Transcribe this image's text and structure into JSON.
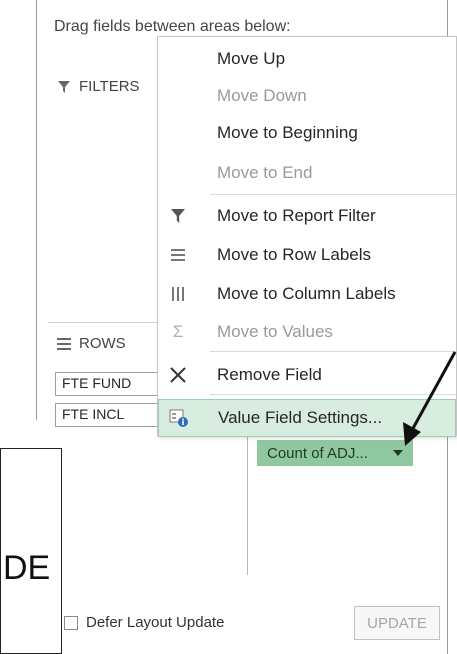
{
  "panel": {
    "drag_hint": "Drag fields between areas below:",
    "filters_label": "FILTERS",
    "rows_label": "ROWS",
    "row_fields": [
      "FTE FUND",
      "FTE INCL"
    ],
    "value_field": "Count of ADJ...",
    "defer_label": "Defer Layout Update",
    "update_label": "UPDATE"
  },
  "context_menu": {
    "items": [
      {
        "label": "Move Up",
        "enabled": true,
        "icon": ""
      },
      {
        "label": "Move Down",
        "enabled": false,
        "icon": ""
      },
      {
        "label": "Move to Beginning",
        "enabled": true,
        "icon": ""
      },
      {
        "label": "Move to End",
        "enabled": false,
        "icon": ""
      },
      {
        "label": "Move to Report Filter",
        "enabled": true,
        "icon": "filter-icon"
      },
      {
        "label": "Move to Row Labels",
        "enabled": true,
        "icon": "rows-icon"
      },
      {
        "label": "Move to Column Labels",
        "enabled": true,
        "icon": "columns-icon"
      },
      {
        "label": "Move to Values",
        "enabled": false,
        "icon": "sigma-icon"
      },
      {
        "label": "Remove Field",
        "enabled": true,
        "icon": "close-x-icon"
      },
      {
        "label": "Value Field Settings...",
        "enabled": true,
        "highlighted": true,
        "icon": "field-settings-icon"
      }
    ]
  },
  "overlay": {
    "text": "DE"
  },
  "colors": {
    "value_pill": "#8fc8a0",
    "menu_highlight": "#d8ecdf",
    "disabled_text": "#9a9a9a"
  }
}
